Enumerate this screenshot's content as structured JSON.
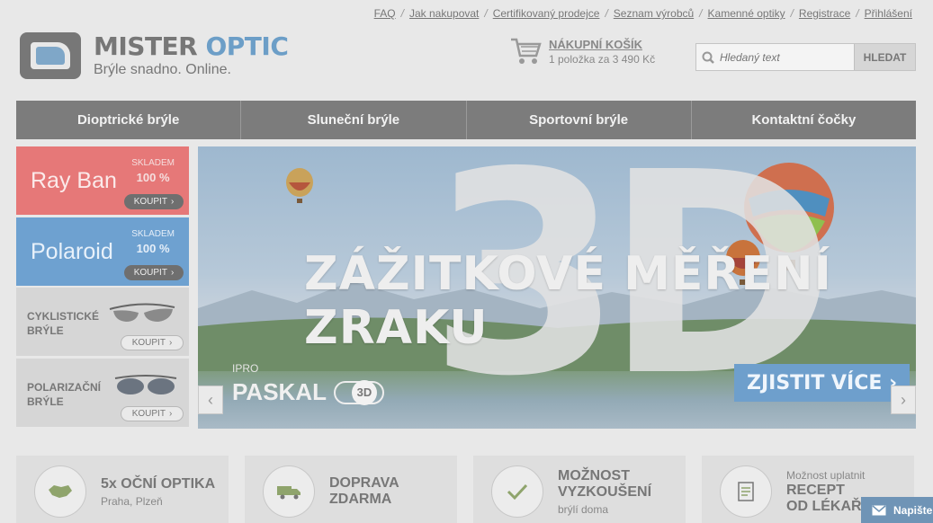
{
  "top_links": [
    "FAQ",
    "Jak nakupovat",
    "Certifikovaný prodejce",
    "Seznam výrobců",
    "Kamenné optiky",
    "Registrace",
    "Přihlášení"
  ],
  "top_sep": "/",
  "logo": {
    "title_part1": "MISTER",
    "title_part2": "OPTIC",
    "tagline": "Brýle snadno. Online."
  },
  "cart": {
    "title": "NÁKUPNÍ KOŠÍK",
    "summary": "1 položka za 3 490 Kč"
  },
  "search": {
    "placeholder": "Hledaný text",
    "button": "HLEDAT"
  },
  "nav": [
    "Dioptrické brýle",
    "Sluneční brýle",
    "Sportovní brýle",
    "Kontaktní čočky"
  ],
  "tiles": {
    "rayban": {
      "brand": "Ray Ban",
      "stock_label": "SKLADEM",
      "stock_pct": "100 %",
      "buy": "KOUPIT"
    },
    "polaroid": {
      "brand": "Polaroid",
      "stock_label": "SKLADEM",
      "stock_pct": "100 %",
      "buy": "KOUPIT"
    },
    "cycling": {
      "line1": "CYKLISTICKÉ",
      "line2": "BRÝLE",
      "buy": "KOUPIT"
    },
    "polarizing": {
      "line1": "POLARIZAČNÍ",
      "line2": "BRÝLE",
      "buy": "KOUPIT"
    }
  },
  "banner": {
    "big_text": "3D",
    "title": "ZÁŽITKOVÉ MĚŘENÍ ZRAKU",
    "brand_small": "IPRO",
    "brand_big": "PASKAL",
    "brand_badge": "3D",
    "cta": "ZJISTIT VÍCE ›",
    "prev": "‹",
    "next": "›"
  },
  "features": [
    {
      "pre": "",
      "big1": "5x OČNÍ OPTIKA",
      "big2": "",
      "small": "Praha, Plzeň",
      "icon": "czech-map-icon"
    },
    {
      "pre": "",
      "big1": "DOPRAVA",
      "big2": "ZDARMA",
      "small": "",
      "icon": "truck-icon"
    },
    {
      "pre": "",
      "big1": "MOŽNOST",
      "big2": "VYZKOUŠENÍ",
      "small": "brýlí doma",
      "icon": "check-icon"
    },
    {
      "pre": "Možnost uplatnit",
      "big1": "RECEPT",
      "big2": "OD LÉKAŘE",
      "small": "",
      "icon": "document-icon"
    }
  ],
  "write_us": "Napište",
  "colors": {
    "accent_blue": "#6e9fcc",
    "rayban_red": "#e67878",
    "polaroid_blue": "#6ea1d0",
    "nav_gray": "#7c7c7c"
  }
}
